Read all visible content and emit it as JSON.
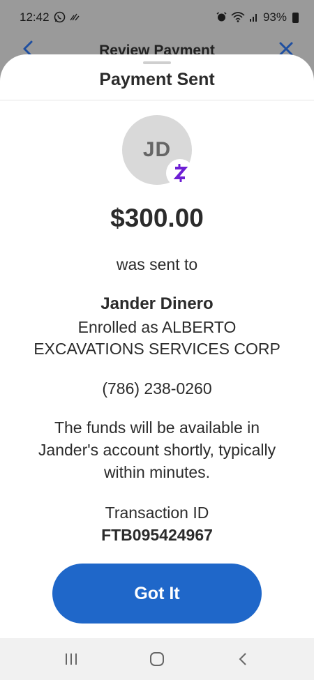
{
  "status_bar": {
    "time": "12:42",
    "battery": "93%",
    "left_icons": [
      "whatsapp-icon",
      "missed-call-icon"
    ],
    "right_icons": [
      "alarm-icon",
      "wifi-icon",
      "signal-icon",
      "battery-icon"
    ]
  },
  "background_header": {
    "title": "Review Payment",
    "back_icon": "chevron-left-icon",
    "close_icon": "close-icon"
  },
  "sheet": {
    "title": "Payment Sent",
    "avatar_initials": "JD",
    "badge_icon": "zelle-icon",
    "amount": "$300.00",
    "sent_to_label": "was sent to",
    "recipient_name": "Jander Dinero",
    "enrolled_line1": "Enrolled as ALBERTO",
    "enrolled_line2": "EXCAVATIONS SERVICES CORP",
    "phone": "(786) 238-0260",
    "funds_line1": "The funds will be available in",
    "funds_line2": "Jander's account shortly, typically",
    "funds_line3": "within minutes.",
    "transaction_label": "Transaction ID",
    "transaction_id": "FTB095424967",
    "button_label": "Got It"
  },
  "colors": {
    "primary_button": "#1f67c9",
    "zelle_purple": "#6d1ed4",
    "avatar_bg": "#d9d9d9",
    "dim_backdrop": "#9a9a9a"
  },
  "nav_bar": {
    "icons": [
      "recent-apps-icon",
      "home-icon",
      "back-icon"
    ]
  }
}
